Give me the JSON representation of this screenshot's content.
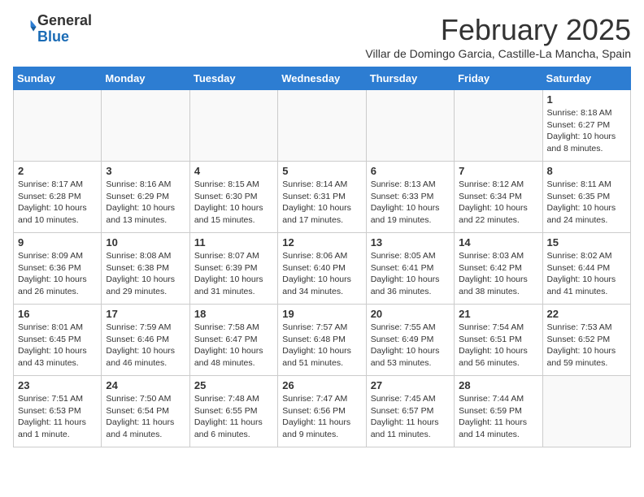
{
  "logo": {
    "general": "General",
    "blue": "Blue"
  },
  "header": {
    "month": "February 2025",
    "location": "Villar de Domingo Garcia, Castille-La Mancha, Spain"
  },
  "weekdays": [
    "Sunday",
    "Monday",
    "Tuesday",
    "Wednesday",
    "Thursday",
    "Friday",
    "Saturday"
  ],
  "weeks": [
    [
      {
        "day": "",
        "info": ""
      },
      {
        "day": "",
        "info": ""
      },
      {
        "day": "",
        "info": ""
      },
      {
        "day": "",
        "info": ""
      },
      {
        "day": "",
        "info": ""
      },
      {
        "day": "",
        "info": ""
      },
      {
        "day": "1",
        "info": "Sunrise: 8:18 AM\nSunset: 6:27 PM\nDaylight: 10 hours and 8 minutes."
      }
    ],
    [
      {
        "day": "2",
        "info": "Sunrise: 8:17 AM\nSunset: 6:28 PM\nDaylight: 10 hours and 10 minutes."
      },
      {
        "day": "3",
        "info": "Sunrise: 8:16 AM\nSunset: 6:29 PM\nDaylight: 10 hours and 13 minutes."
      },
      {
        "day": "4",
        "info": "Sunrise: 8:15 AM\nSunset: 6:30 PM\nDaylight: 10 hours and 15 minutes."
      },
      {
        "day": "5",
        "info": "Sunrise: 8:14 AM\nSunset: 6:31 PM\nDaylight: 10 hours and 17 minutes."
      },
      {
        "day": "6",
        "info": "Sunrise: 8:13 AM\nSunset: 6:33 PM\nDaylight: 10 hours and 19 minutes."
      },
      {
        "day": "7",
        "info": "Sunrise: 8:12 AM\nSunset: 6:34 PM\nDaylight: 10 hours and 22 minutes."
      },
      {
        "day": "8",
        "info": "Sunrise: 8:11 AM\nSunset: 6:35 PM\nDaylight: 10 hours and 24 minutes."
      }
    ],
    [
      {
        "day": "9",
        "info": "Sunrise: 8:09 AM\nSunset: 6:36 PM\nDaylight: 10 hours and 26 minutes."
      },
      {
        "day": "10",
        "info": "Sunrise: 8:08 AM\nSunset: 6:38 PM\nDaylight: 10 hours and 29 minutes."
      },
      {
        "day": "11",
        "info": "Sunrise: 8:07 AM\nSunset: 6:39 PM\nDaylight: 10 hours and 31 minutes."
      },
      {
        "day": "12",
        "info": "Sunrise: 8:06 AM\nSunset: 6:40 PM\nDaylight: 10 hours and 34 minutes."
      },
      {
        "day": "13",
        "info": "Sunrise: 8:05 AM\nSunset: 6:41 PM\nDaylight: 10 hours and 36 minutes."
      },
      {
        "day": "14",
        "info": "Sunrise: 8:03 AM\nSunset: 6:42 PM\nDaylight: 10 hours and 38 minutes."
      },
      {
        "day": "15",
        "info": "Sunrise: 8:02 AM\nSunset: 6:44 PM\nDaylight: 10 hours and 41 minutes."
      }
    ],
    [
      {
        "day": "16",
        "info": "Sunrise: 8:01 AM\nSunset: 6:45 PM\nDaylight: 10 hours and 43 minutes."
      },
      {
        "day": "17",
        "info": "Sunrise: 7:59 AM\nSunset: 6:46 PM\nDaylight: 10 hours and 46 minutes."
      },
      {
        "day": "18",
        "info": "Sunrise: 7:58 AM\nSunset: 6:47 PM\nDaylight: 10 hours and 48 minutes."
      },
      {
        "day": "19",
        "info": "Sunrise: 7:57 AM\nSunset: 6:48 PM\nDaylight: 10 hours and 51 minutes."
      },
      {
        "day": "20",
        "info": "Sunrise: 7:55 AM\nSunset: 6:49 PM\nDaylight: 10 hours and 53 minutes."
      },
      {
        "day": "21",
        "info": "Sunrise: 7:54 AM\nSunset: 6:51 PM\nDaylight: 10 hours and 56 minutes."
      },
      {
        "day": "22",
        "info": "Sunrise: 7:53 AM\nSunset: 6:52 PM\nDaylight: 10 hours and 59 minutes."
      }
    ],
    [
      {
        "day": "23",
        "info": "Sunrise: 7:51 AM\nSunset: 6:53 PM\nDaylight: 11 hours and 1 minute."
      },
      {
        "day": "24",
        "info": "Sunrise: 7:50 AM\nSunset: 6:54 PM\nDaylight: 11 hours and 4 minutes."
      },
      {
        "day": "25",
        "info": "Sunrise: 7:48 AM\nSunset: 6:55 PM\nDaylight: 11 hours and 6 minutes."
      },
      {
        "day": "26",
        "info": "Sunrise: 7:47 AM\nSunset: 6:56 PM\nDaylight: 11 hours and 9 minutes."
      },
      {
        "day": "27",
        "info": "Sunrise: 7:45 AM\nSunset: 6:57 PM\nDaylight: 11 hours and 11 minutes."
      },
      {
        "day": "28",
        "info": "Sunrise: 7:44 AM\nSunset: 6:59 PM\nDaylight: 11 hours and 14 minutes."
      },
      {
        "day": "",
        "info": ""
      }
    ]
  ]
}
